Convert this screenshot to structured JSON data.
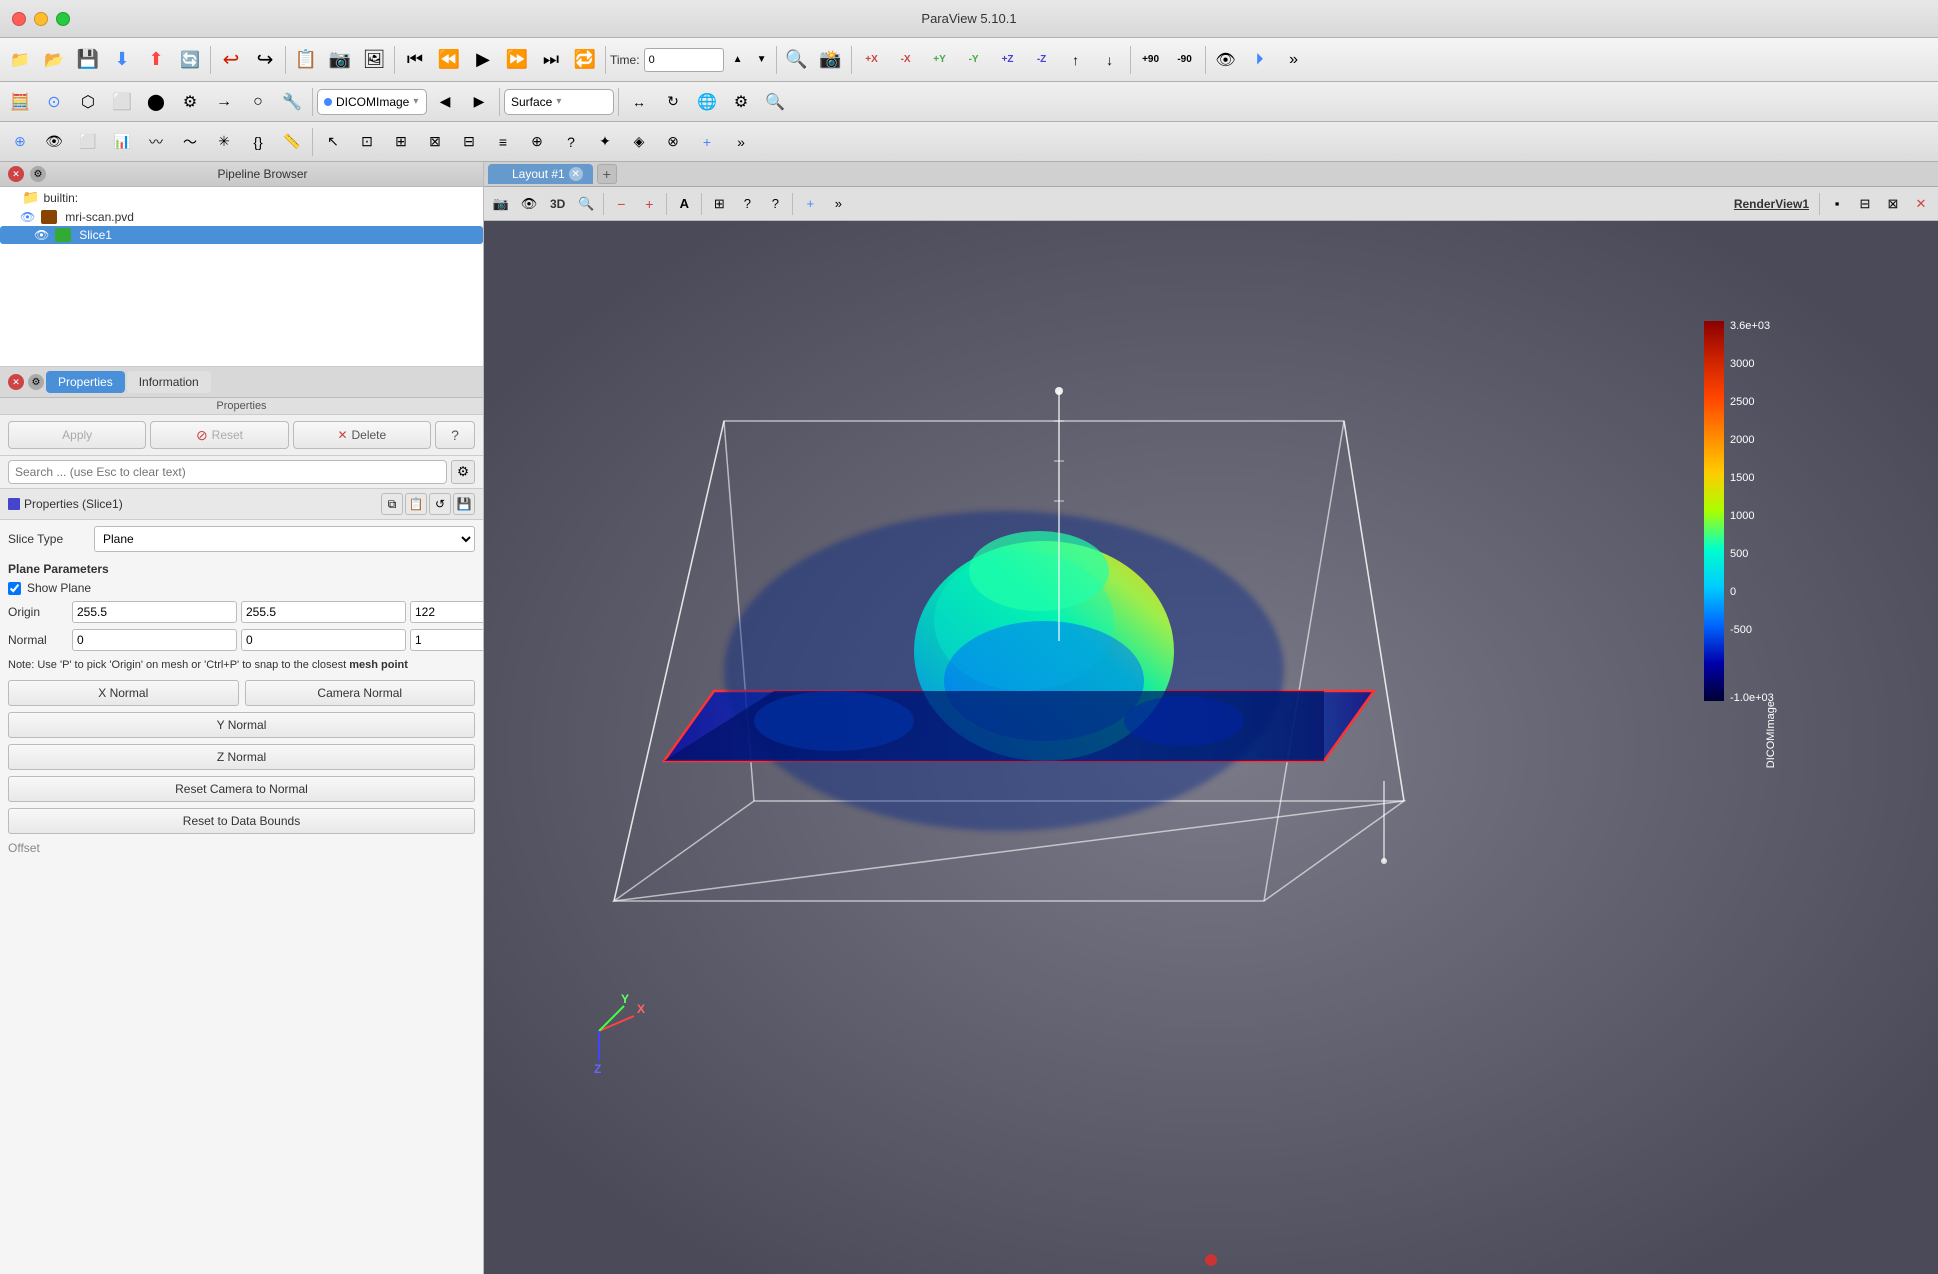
{
  "app": {
    "title": "ParaView 5.10.1"
  },
  "title_bar": {
    "close": "×",
    "min": "−",
    "max": "+"
  },
  "toolbar1": {
    "time_label": "Time:",
    "time_value": "0",
    "buttons": [
      "📁",
      "📂",
      "💾",
      "⬇",
      "⬆",
      "🔄",
      "◀",
      "⏮",
      "▶",
      "⏭",
      "⏩",
      "⏺"
    ]
  },
  "toolbar2": {
    "source_label": "DICOMImage",
    "representation_label": "Surface"
  },
  "pipeline_browser": {
    "title": "Pipeline Browser",
    "items": [
      {
        "label": "builtin:",
        "indent": 0,
        "type": "root"
      },
      {
        "label": "mri-scan.pvd",
        "indent": 1,
        "type": "file"
      },
      {
        "label": "Slice1",
        "indent": 2,
        "type": "slice",
        "selected": true
      }
    ]
  },
  "properties_panel": {
    "title": "Properties",
    "tabs": [
      {
        "label": "Properties",
        "active": true
      },
      {
        "label": "Information",
        "active": false
      }
    ],
    "sub_header": "Properties",
    "buttons": {
      "apply": "Apply",
      "reset": "Reset",
      "delete": "Delete",
      "help": "?"
    },
    "search_placeholder": "Search ... (use Esc to clear text)",
    "section_title": "Properties (Slice1)",
    "slice_type_label": "Slice Type",
    "slice_type_value": "Plane",
    "plane_params_title": "Plane Parameters",
    "show_plane_label": "Show Plane",
    "origin_label": "Origin",
    "origin_x": "255.5",
    "origin_y": "255.5",
    "origin_z": "122",
    "normal_label": "Normal",
    "normal_x": "0",
    "normal_y": "0",
    "normal_z": "1",
    "note": "Note: Use 'P' to pick 'Origin' on mesh or 'Ctrl+P' to snap to the closest mesh point",
    "buttons_normal": {
      "x_normal": "X Normal",
      "y_normal": "Y Normal",
      "z_normal": "Z Normal",
      "camera_normal": "Camera Normal",
      "reset_camera": "Reset Camera to Normal",
      "reset_data": "Reset to Data Bounds"
    },
    "offset_label": "Offset"
  },
  "viewport": {
    "tab_label": "Layout #1",
    "view_label": "RenderView1",
    "legend": {
      "title": "DICOMImage",
      "values": [
        "3.6e+03",
        "3000",
        "2500",
        "2000",
        "1500",
        "1000",
        "500",
        "0",
        "-500",
        "-1.0e+03"
      ]
    }
  },
  "icons": {
    "close": "✕",
    "settings": "⚙",
    "copy": "⧉",
    "save": "💾",
    "refresh": "↺",
    "eye": "👁",
    "plus": "+",
    "minus": "−",
    "check": "✓",
    "x": "✕",
    "delete": "✕",
    "chevron_down": "▾",
    "question": "?",
    "gear": "⚙"
  }
}
